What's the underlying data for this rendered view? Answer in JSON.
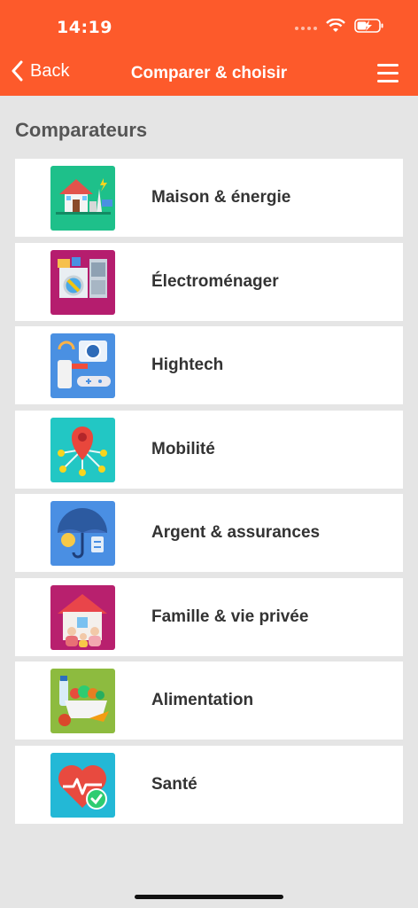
{
  "status": {
    "time": "14:19"
  },
  "nav": {
    "back_label": "Back",
    "title": "Comparer & choisir"
  },
  "section": {
    "title": "Comparateurs"
  },
  "categories": [
    {
      "label": "Maison & énergie",
      "icon": "house-energy-icon",
      "color": "#1ec08a"
    },
    {
      "label": "Électroménager",
      "icon": "appliances-icon",
      "color": "#b51d6e"
    },
    {
      "label": "Hightech",
      "icon": "hightech-icon",
      "color": "#4a90e2"
    },
    {
      "label": "Mobilité",
      "icon": "map-pin-network-icon",
      "color": "#22c7c4"
    },
    {
      "label": "Argent & assurances",
      "icon": "umbrella-coin-icon",
      "color": "#4a8fe3"
    },
    {
      "label": "Famille & vie privée",
      "icon": "family-house-icon",
      "color": "#b8206e"
    },
    {
      "label": "Alimentation",
      "icon": "food-basket-icon",
      "color": "#8dbb3f"
    },
    {
      "label": "Santé",
      "icon": "heart-health-icon",
      "color": "#23b8d6"
    }
  ]
}
